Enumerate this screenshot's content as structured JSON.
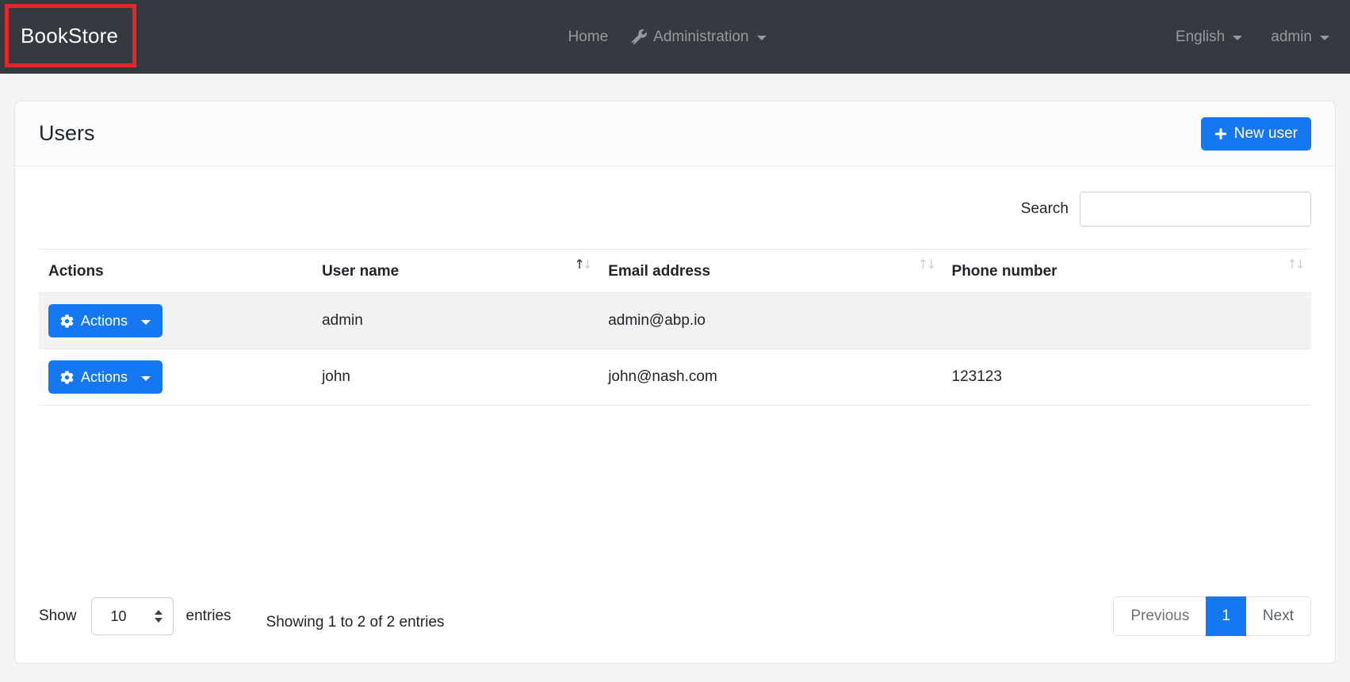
{
  "navbar": {
    "brand": "BookStore",
    "home_label": "Home",
    "administration_label": "Administration",
    "language_label": "English",
    "user_label": "admin"
  },
  "page": {
    "title": "Users",
    "new_user_label": "New user"
  },
  "search": {
    "label": "Search",
    "value": ""
  },
  "table": {
    "action_button_label": "Actions",
    "columns": [
      {
        "label": "Actions",
        "sortable": false,
        "sort": "none"
      },
      {
        "label": "User name",
        "sortable": true,
        "sort": "asc"
      },
      {
        "label": "Email address",
        "sortable": true,
        "sort": "none"
      },
      {
        "label": "Phone number",
        "sortable": true,
        "sort": "none"
      }
    ],
    "rows": [
      {
        "user_name": "admin",
        "email": "admin@abp.io",
        "phone": ""
      },
      {
        "user_name": "john",
        "email": "john@nash.com",
        "phone": "123123"
      }
    ]
  },
  "footer": {
    "show_label": "Show",
    "page_size": "10",
    "entries_label": "entries",
    "info": "Showing 1 to 2 of 2 entries",
    "pagination": {
      "previous": "Previous",
      "current": "1",
      "next": "Next"
    }
  },
  "colors": {
    "primary": "#1577f2",
    "navbar_bg": "#343a40",
    "annotation_red": "#e8252a",
    "row_stripe": "#f2f2f2",
    "page_bg": "#f4f5f7"
  }
}
